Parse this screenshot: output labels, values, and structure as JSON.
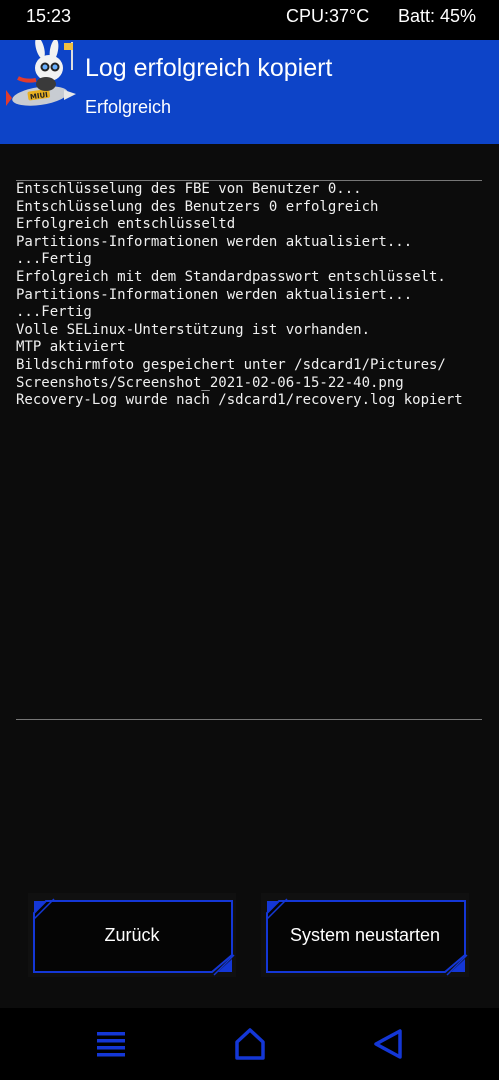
{
  "status_bar": {
    "time": "15:23",
    "cpu": "CPU:37°C",
    "battery": "Batt: 45%"
  },
  "header": {
    "title": "Log erfolgreich kopiert",
    "subtitle": "Erfolgreich",
    "logo_text": "MIUI"
  },
  "console": {
    "lines": [
      "Entschlüsselung des FBE von Benutzer 0...",
      "Entschlüsselung des Benutzers 0 erfolgreich",
      "Erfolgreich entschlüsseltd",
      "Partitions-Informationen werden aktualisiert...",
      "...Fertig",
      "Erfolgreich mit dem Standardpasswort entschlüsselt.",
      "Partitions-Informationen werden aktualisiert...",
      "...Fertig",
      "Volle SELinux-Unterstützung ist vorhanden.",
      "MTP aktiviert",
      "Bildschirmfoto gespeichert unter /sdcard1/Pictures/",
      "Screenshots/Screenshot_2021-02-06-15-22-40.png",
      "Recovery-Log wurde nach /sdcard1/recovery.log kopiert"
    ]
  },
  "buttons": {
    "back_label": "Zurück",
    "reboot_label": "System neustarten"
  },
  "nav_icons": {
    "menu": "menu-icon",
    "home": "home-icon",
    "back": "back-icon"
  },
  "colors": {
    "accent": "#0d44c8",
    "button_border": "#1437d6",
    "background": "#0c0c0c"
  }
}
